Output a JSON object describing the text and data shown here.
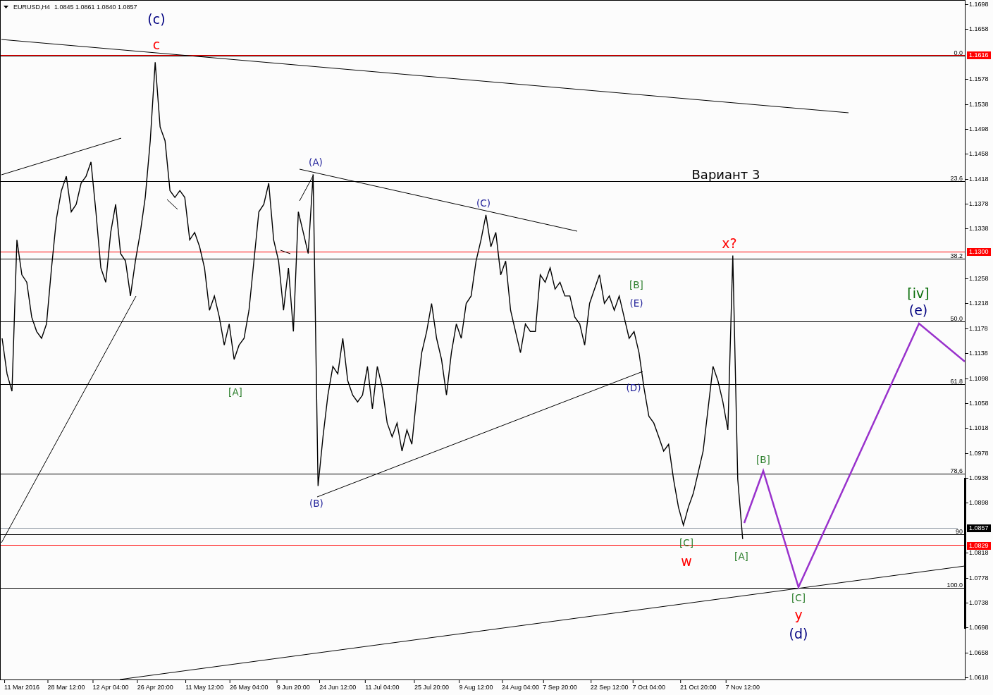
{
  "header": {
    "quote": "1.0845 1.0861 1.0840 1.0857"
  },
  "chart_data": {
    "type": "line",
    "ylim": [
      1.06146,
      1.17037
    ],
    "categories": [
      null,
      null,
      null,
      null,
      "11 Mar 2016",
      null,
      null,
      null,
      null,
      null,
      null,
      null,
      null,
      "28 Mar 12:00",
      null,
      null,
      null,
      null,
      null,
      null,
      null,
      null,
      "12 Apr 04:00",
      null,
      null,
      null,
      null,
      null,
      null,
      null,
      null,
      "26 Apr 20:00",
      null,
      null,
      null,
      null,
      null,
      null,
      null,
      null,
      null,
      "11 May 12:00",
      null,
      null,
      null,
      null,
      null,
      null,
      null,
      null,
      "26 May 04:00",
      null,
      null,
      null,
      null,
      null,
      null,
      null,
      null,
      "9 Jun 20:00",
      null,
      null,
      null,
      null,
      null,
      null,
      null,
      null,
      "24 Jun 12:00",
      null,
      null,
      null,
      null,
      null,
      null,
      null,
      null,
      "11 Jul 04:00",
      null,
      null,
      null,
      null,
      null,
      null,
      null,
      null,
      null,
      "25 Jul 20:00",
      null,
      null,
      null,
      null,
      null,
      null,
      null,
      null,
      "9 Aug 12:00",
      null,
      null,
      null,
      null,
      null,
      null,
      null,
      null,
      "24 Aug 04:00",
      null,
      null,
      null,
      null,
      null,
      null,
      null,
      "7 Sep 20:00",
      null,
      null,
      null,
      null,
      null,
      null,
      null,
      null,
      null,
      "22 Sep 12:00",
      null,
      null,
      null,
      null,
      null,
      null,
      null,
      "7 Oct 04:00",
      null,
      null,
      null,
      null,
      null,
      null,
      null,
      null,
      null,
      "21 Oct 20:00",
      null,
      null,
      null,
      null,
      null,
      null,
      null,
      null,
      "7 Nov 12:00",
      null,
      null,
      null,
      null,
      null,
      null,
      null,
      null,
      null,
      null,
      null,
      null,
      null,
      null,
      null,
      null,
      null,
      null,
      null,
      null,
      null,
      null,
      null,
      null,
      null,
      null,
      null,
      null,
      null,
      null,
      null,
      null,
      null,
      null,
      null,
      null,
      null,
      null,
      null,
      null,
      null,
      null,
      null,
      null
    ],
    "yticks": [
      1.1698,
      1.1658,
      1.1578,
      1.1538,
      1.1498,
      1.1458,
      1.1418,
      1.1378,
      1.1338,
      1.1258,
      1.1218,
      1.1178,
      1.1138,
      1.1098,
      1.1058,
      1.1018,
      1.0978,
      1.0938,
      1.0898,
      1.0818,
      1.0778,
      1.0738,
      1.0698,
      1.0658,
      1.0618
    ],
    "series": [
      {
        "name": "EURUSD,H4",
        "color": "#000000",
        "values": [
          1.1162,
          1.1105,
          1.1077,
          1.132,
          1.1264,
          1.1252,
          1.1196,
          1.1173,
          1.1162,
          1.1185,
          1.1275,
          1.1354,
          1.1399,
          1.1422,
          1.1365,
          1.1377,
          1.1411,
          1.1422,
          1.1445,
          1.1365,
          1.1275,
          1.1252,
          1.1332,
          1.1377,
          1.1298,
          1.1286,
          1.123,
          1.1286,
          1.1332,
          1.1388,
          1.1479,
          1.1605,
          1.1501,
          1.1479,
          1.1399,
          1.1388,
          1.1399,
          1.1388,
          1.132,
          1.1332,
          1.1309,
          1.1275,
          1.1207,
          1.123,
          1.1196,
          1.1151,
          1.1185,
          1.1128,
          1.1151,
          1.1162,
          1.1207,
          1.1286,
          1.1365,
          1.1377,
          1.1411,
          1.132,
          1.1286,
          1.1207,
          1.1275,
          1.1173,
          1.1365,
          1.1332,
          1.1298,
          1.1425,
          1.0925,
          1.1004,
          1.1071,
          1.1117,
          1.1105,
          1.1162,
          1.1094,
          1.1071,
          1.106,
          1.1071,
          1.1117,
          1.1049,
          1.1117,
          1.1083,
          1.1026,
          1.1004,
          1.1026,
          1.0981,
          1.1015,
          1.0992,
          1.1071,
          1.1139,
          1.1173,
          1.1218,
          1.1162,
          1.1128,
          1.1071,
          1.1139,
          1.1185,
          1.1162,
          1.1218,
          1.123,
          1.1286,
          1.132,
          1.136,
          1.1309,
          1.1332,
          1.1264,
          1.1286,
          1.1207,
          1.1173,
          1.1139,
          1.1185,
          1.1173,
          1.1173,
          1.1264,
          1.1252,
          1.1275,
          1.1241,
          1.1252,
          1.123,
          1.123,
          1.1196,
          1.1185,
          1.1151,
          1.1218,
          1.1241,
          1.1264,
          1.1218,
          1.123,
          1.1207,
          1.123,
          1.1196,
          1.1162,
          1.1173,
          1.1139,
          1.1083,
          1.1037,
          1.1026,
          1.1004,
          1.0981,
          1.0992,
          1.0936,
          1.0891,
          1.0862,
          1.0891,
          1.0913,
          1.0947,
          1.0981,
          1.1049,
          1.1117,
          1.1094,
          1.106,
          1.1015,
          1.1295,
          1.0936,
          1.084,
          null,
          null,
          null,
          null,
          null,
          null,
          null,
          null,
          null,
          null,
          null,
          null,
          null,
          null,
          null,
          null,
          null,
          null,
          null,
          null,
          null,
          null,
          null,
          null,
          null,
          null,
          null,
          null,
          null,
          null,
          null,
          null,
          null,
          null,
          null,
          null,
          null,
          null,
          null,
          null,
          null,
          null,
          null,
          null
        ]
      }
    ],
    "ref_lines": [
      {
        "axis": "y",
        "value": 1.1616,
        "color": "#ff0000"
      },
      {
        "axis": "y",
        "value": 1.13,
        "color": "#ff0000"
      },
      {
        "axis": "y",
        "value": 1.0857,
        "color": "#9aa2ac"
      },
      {
        "axis": "y",
        "value": 1.0829,
        "color": "#ff0000"
      },
      {
        "axis": "y",
        "value": 1.1616,
        "color": "#000000"
      }
    ]
  },
  "price_tags": [
    {
      "text": "1.1616",
      "color": "#ff0000",
      "kind": "level"
    },
    {
      "text": "1.1300",
      "color": "#ff0000",
      "kind": "level"
    },
    {
      "text": "1.0857",
      "color": "#000000",
      "kind": "bid"
    },
    {
      "text": "1.0829",
      "color": "#ff0000",
      "kind": "level"
    }
  ],
  "fibonacci_levels": [
    {
      "label": "0.0"
    },
    {
      "label": "23.6"
    },
    {
      "label": "38.2"
    },
    {
      "label": "50.0"
    },
    {
      "label": "61.8"
    },
    {
      "label": "78,6"
    },
    {
      "label": "90"
    },
    {
      "label": "100.0"
    }
  ],
  "wave_labels": [
    {
      "text": "(c)",
      "color": "#000080"
    },
    {
      "text": "c",
      "color": "#ff0000"
    },
    {
      "text": "(A)",
      "color": "#22229a"
    },
    {
      "text": "[A]",
      "color": "#2a7d2a"
    },
    {
      "text": "(C)",
      "color": "#22229a"
    },
    {
      "text": "(B)",
      "color": "#22229a"
    },
    {
      "text": "[B]",
      "color": "#2a7d2a"
    },
    {
      "text": "(E)",
      "color": "#22229a"
    },
    {
      "text": "(D)",
      "color": "#22229a"
    },
    {
      "text": "x?",
      "color": "#ff0000"
    },
    {
      "text": "[C]",
      "color": "#2a7d2a"
    },
    {
      "text": "w",
      "color": "#ff0000"
    },
    {
      "text": "[A]",
      "color": "#2a7d2a"
    },
    {
      "text": "[B]",
      "color": "#2a7d2a"
    },
    {
      "text": "[C]",
      "color": "#2a7d2a"
    },
    {
      "text": "y",
      "color": "#ff0000"
    },
    {
      "text": "(d)",
      "color": "#000080"
    },
    {
      "text": "[iv]",
      "color": "#0b6e0b"
    },
    {
      "text": "(e)",
      "color": "#000080"
    }
  ],
  "caption": "Вариант 3"
}
